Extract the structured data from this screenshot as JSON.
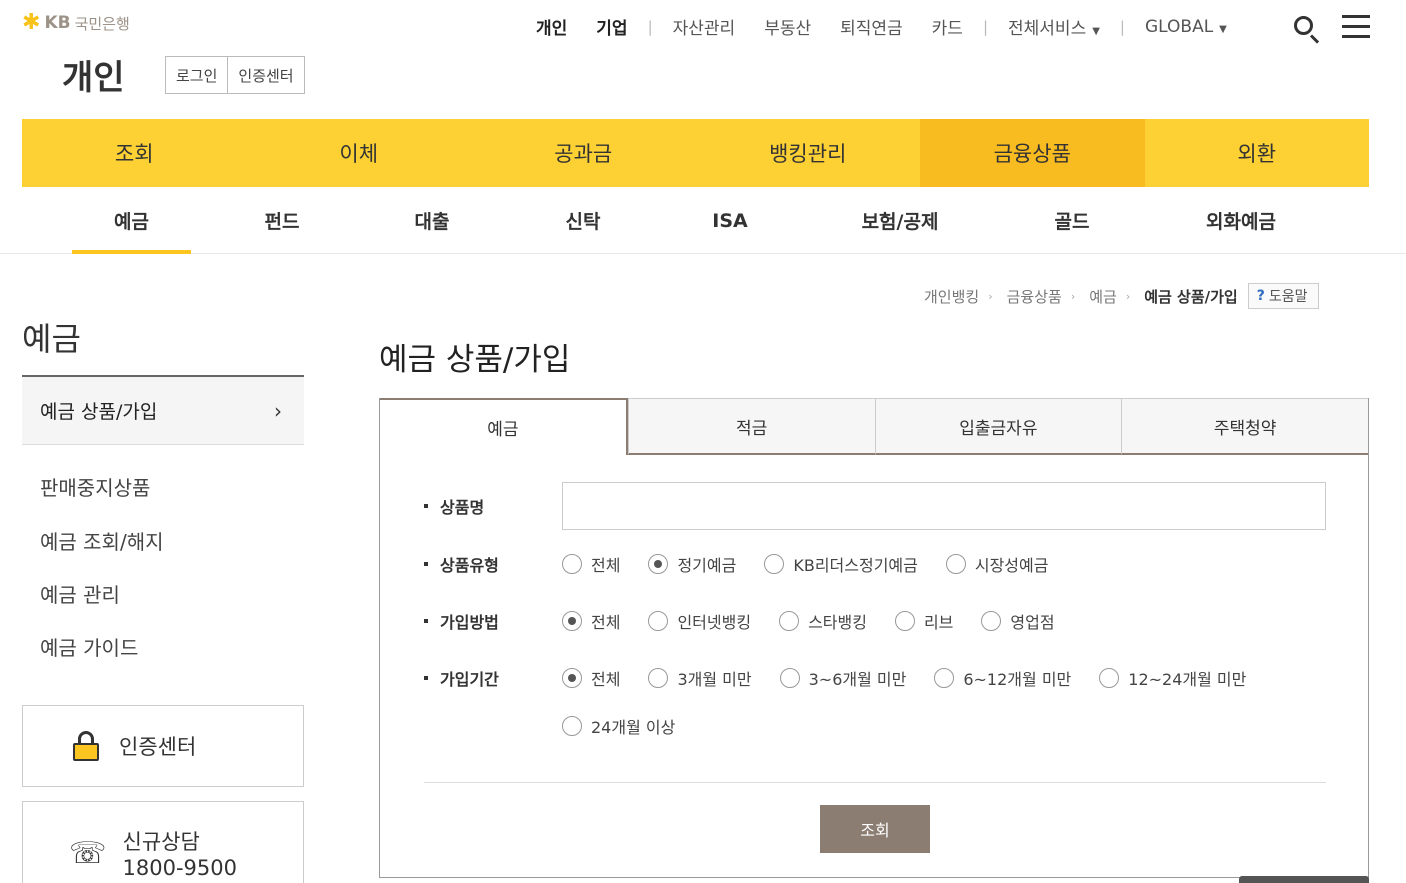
{
  "logo": {
    "mark": "KB",
    "text": "국민은행"
  },
  "section_title": "개인",
  "login": {
    "login_label": "로그인",
    "cert_label": "인증센터"
  },
  "topnav": {
    "personal": "개인",
    "corporate": "기업",
    "asset": "자산관리",
    "realestate": "부동산",
    "pension": "퇴직연금",
    "card": "카드",
    "all_services": "전체서비스",
    "global": "GLOBAL"
  },
  "mainnav": {
    "tabs": [
      "조회",
      "이체",
      "공과금",
      "뱅킹관리",
      "금융상품",
      "외환"
    ],
    "active_index": 4
  },
  "subnav": {
    "tabs": [
      "예금",
      "펀드",
      "대출",
      "신탁",
      "ISA",
      "보험/공제",
      "골드",
      "외화예금"
    ],
    "active_index": 0
  },
  "breadcrumb": {
    "items": [
      "개인뱅킹",
      "금융상품",
      "예금",
      "예금 상품/가입"
    ],
    "help_label": "도움말",
    "help_mark": "?"
  },
  "sidebar": {
    "title": "예금",
    "active_item": "예금 상품/가입",
    "links": [
      "판매중지상품",
      "예금 조회/해지",
      "예금 관리",
      "예금 가이드"
    ],
    "cert_box": "인증센터",
    "consult_label": "신규상담",
    "consult_phone": "1800-9500"
  },
  "main": {
    "title": "예금 상품/가입",
    "tabs": [
      "예금",
      "적금",
      "입출금자유",
      "주택청약"
    ],
    "active_tab": 0,
    "form": {
      "product_name_label": "상품명",
      "product_name_value": "",
      "product_type_label": "상품유형",
      "product_type_options": [
        "전체",
        "정기예금",
        "KB리더스정기예금",
        "시장성예금"
      ],
      "product_type_selected": 1,
      "join_method_label": "가입방법",
      "join_method_options": [
        "전체",
        "인터넷뱅킹",
        "스타뱅킹",
        "리브",
        "영업점"
      ],
      "join_method_selected": 0,
      "join_period_label": "가입기간",
      "join_period_options": [
        "전체",
        "3개월 미만",
        "3~6개월 미만",
        "6~12개월 미만",
        "12~24개월 미만",
        "24개월 이상"
      ],
      "join_period_selected": 0,
      "submit_label": "조회"
    }
  },
  "colors": {
    "brand_yellow": "#fdd034",
    "active_yellow": "#f8bb20",
    "accent_brown": "#8c7d73"
  }
}
